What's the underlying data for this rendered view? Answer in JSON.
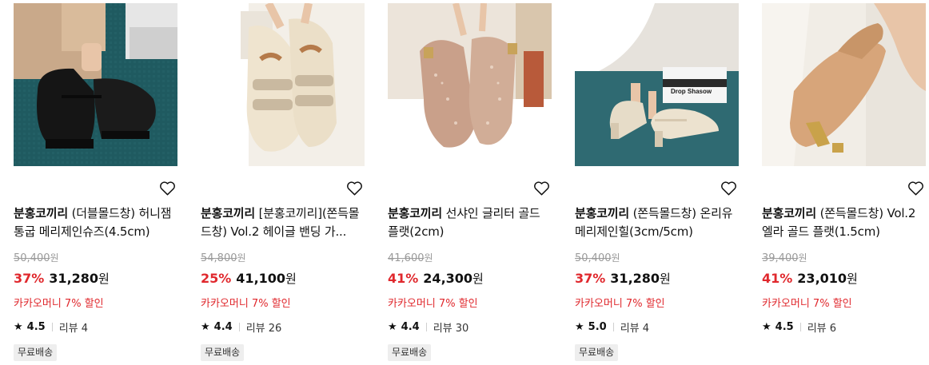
{
  "products": [
    {
      "brand": "분홍코끼리",
      "name": "(더블몰드창) 허니잼 통굽 메리제인슈즈(4.5cm)",
      "original_price": "50,400",
      "price_unit": "원",
      "discount": "37%",
      "price": "31,280",
      "promo": "카카오머니 7% 할인",
      "rating": "4.5",
      "review_label": "리뷰",
      "review_count": "4",
      "badge": "무료배송",
      "image_icon": "black-mary-jane-shoes-image"
    },
    {
      "brand": "분홍코끼리",
      "name": "[분홍코끼리](쫀득몰드창) Vol.2 헤이글 밴딩 가...",
      "original_price": "54,800",
      "price_unit": "원",
      "discount": "25%",
      "price": "41,100",
      "promo": "카카오머니 7% 할인",
      "rating": "4.4",
      "review_label": "리뷰",
      "review_count": "26",
      "badge": "무료배송",
      "image_icon": "ivory-velcro-sneakers-image"
    },
    {
      "brand": "분홍코끼리",
      "name": "선샤인 글리터 골드 플랫(2cm)",
      "original_price": "41,600",
      "price_unit": "원",
      "discount": "41%",
      "price": "24,300",
      "promo": "카카오머니 7% 할인",
      "rating": "4.4",
      "review_label": "리뷰",
      "review_count": "30",
      "badge": "무료배송",
      "image_icon": "glitter-gold-flats-image"
    },
    {
      "brand": "분홍코끼리",
      "name": "(쫀득몰드창) 온리유 메리제인힐(3cm/5cm)",
      "original_price": "50,400",
      "price_unit": "원",
      "discount": "37%",
      "price": "31,280",
      "promo": "카카오머니 7% 할인",
      "rating": "5.0",
      "review_label": "리뷰",
      "review_count": "4",
      "badge": "무료배송",
      "image_icon": "cream-mary-jane-heels-image"
    },
    {
      "brand": "분홍코끼리",
      "name": "(쫀득몰드창) Vol.2 엘라 골드 플랫(1.5cm)",
      "original_price": "39,400",
      "price_unit": "원",
      "discount": "41%",
      "price": "23,010",
      "promo": "카카오머니 7% 할인",
      "rating": "4.5",
      "review_label": "리뷰",
      "review_count": "6",
      "badge": "",
      "image_icon": "camel-gold-toe-flats-image"
    }
  ],
  "image_texts": {
    "book": "Drop Shasow"
  },
  "colors": {
    "discount": "#e0282d",
    "promo": "#e0282d",
    "strike": "#9a9a9a",
    "badge_bg": "#eeeeee"
  }
}
